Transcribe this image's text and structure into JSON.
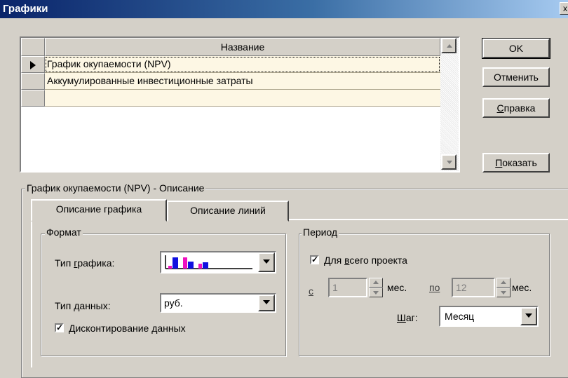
{
  "window": {
    "title": "Графики",
    "close_glyph": "x"
  },
  "grid": {
    "column_header": "Название",
    "rows": [
      {
        "name": "График окупаемости (NPV)",
        "selected": true
      },
      {
        "name": "Аккумулированные инвестиционные затраты",
        "selected": false
      },
      {
        "name": "",
        "selected": false
      }
    ]
  },
  "buttons": {
    "ok": "OK",
    "cancel": "Отменить",
    "help": "Справка",
    "help_hotkey": "С",
    "help_rest": "правка",
    "show": "Показать",
    "show_hotkey": "П",
    "show_rest": "оказать"
  },
  "description_group": {
    "label": "График окупаемости (NPV) - Описание"
  },
  "tabs": [
    {
      "label": "Описание графика",
      "active": true
    },
    {
      "label": "Описание линий",
      "active": false
    }
  ],
  "format": {
    "label": "Формат",
    "chart_type_label_pre": "Тип ",
    "chart_type_label_hot": "г",
    "chart_type_label_post": "рафика:",
    "chart_type_icon": "bar-chart-icon",
    "data_type_label_pre": "Тип ",
    "data_type_label_hot": "д",
    "data_type_label_post": "анных:",
    "data_type_value": "руб.",
    "discount_checked": true,
    "discount_hot": "Д",
    "discount_rest": "исконтирование данных"
  },
  "period": {
    "label": "Период",
    "whole_project_checked": true,
    "whole_project_pre": "Для ",
    "whole_project_hot": "в",
    "whole_project_post": "сего проекта",
    "from_label": "с",
    "from_value": "1",
    "from_unit": "мес.",
    "to_label": "по",
    "to_value": "12",
    "to_unit": "мес.",
    "step_hot": "Ш",
    "step_rest": "аг:",
    "step_value": "Месяц"
  },
  "colors": {
    "title_start": "#0a246a",
    "title_end": "#a6caf0",
    "row_bg": "#fdf7e4",
    "bar_blue": "#1010e0",
    "bar_magenta": "#f010c0"
  }
}
